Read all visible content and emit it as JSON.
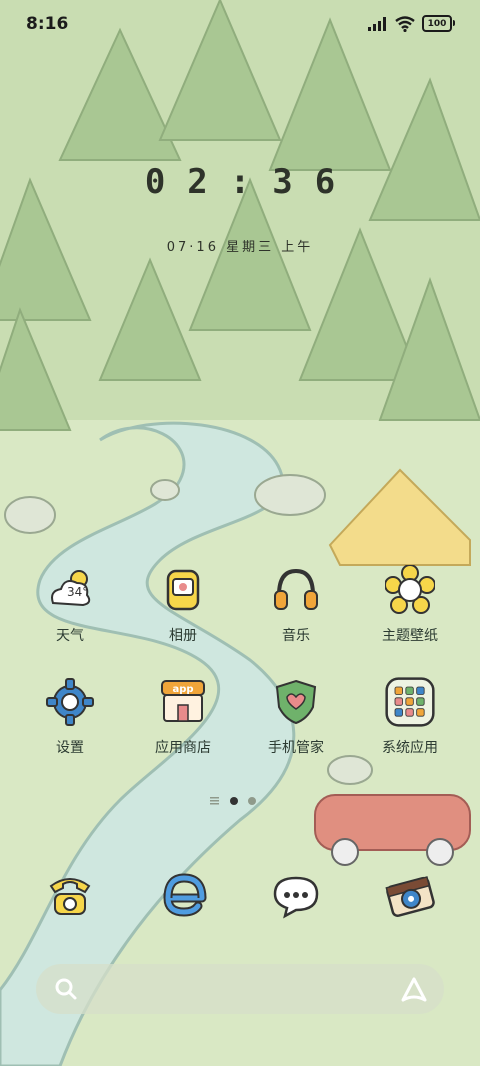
{
  "status_bar": {
    "time": "8:16",
    "battery": "100",
    "icons": [
      "signal-icon",
      "wifi-icon",
      "battery-icon"
    ]
  },
  "clock": {
    "time": "02:36",
    "date": "07·16 星期三 上午"
  },
  "apps": [
    {
      "name": "weather",
      "label": "天气",
      "temp": "34°",
      "icon": "weather-icon"
    },
    {
      "name": "album",
      "label": "相册",
      "icon": "album-icon"
    },
    {
      "name": "music",
      "label": "音乐",
      "icon": "headphones-icon"
    },
    {
      "name": "themes",
      "label": "主题壁纸",
      "icon": "flower-icon"
    },
    {
      "name": "settings",
      "label": "设置",
      "icon": "gear-icon"
    },
    {
      "name": "app-store",
      "label": "应用商店",
      "store_sign": "app",
      "icon": "store-icon"
    },
    {
      "name": "phone-manager",
      "label": "手机管家",
      "icon": "shield-heart-icon"
    },
    {
      "name": "system-apps",
      "label": "系统应用",
      "icon": "app-grid-icon"
    }
  ],
  "page_indicator": {
    "pages": 2,
    "active": 1
  },
  "dock": [
    {
      "name": "phone",
      "icon": "telephone-icon"
    },
    {
      "name": "browser",
      "icon": "browser-e-icon"
    },
    {
      "name": "messages",
      "icon": "chat-bubble-icon"
    },
    {
      "name": "camera",
      "icon": "camera-icon"
    }
  ],
  "search_bar": {
    "left_icon": "search-icon",
    "right_icon": "assistant-icon"
  },
  "colors": {
    "grass": "#d9e8c4",
    "river": "#cfe7df",
    "tree": "#9fbf8a",
    "accent_yellow": "#f6d64a",
    "text": "#2c3b32"
  }
}
